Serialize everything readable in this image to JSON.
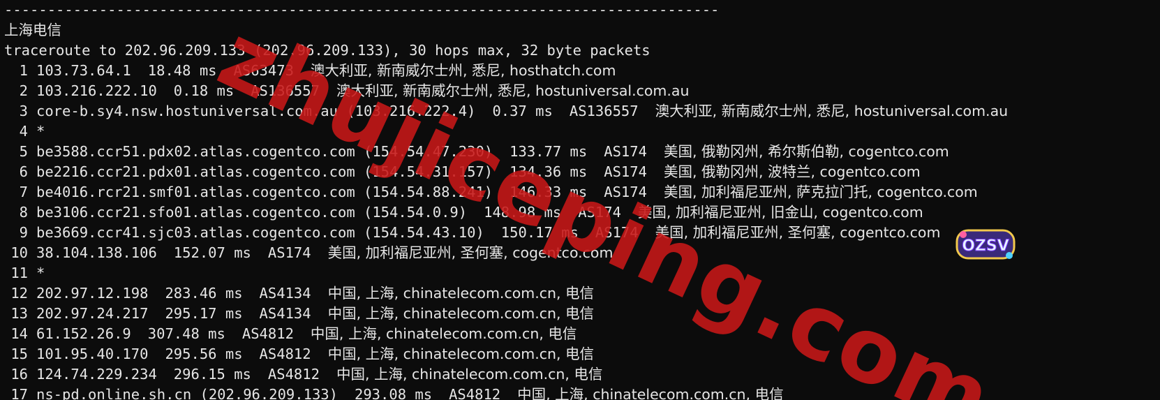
{
  "terminal": {
    "separator": "-----------------------------------------------------------------------------------",
    "title": "上海电信",
    "command": "traceroute to 202.96.209.133 (202.96.209.133), 30 hops max, 32 byte packets",
    "hops": [
      {
        "num": "1",
        "host": "103.73.64.1",
        "time": "18.48 ms",
        "asn": "AS63473",
        "geo": "澳大利亚, 新南威尔士州, 悉尼, hosthatch.com"
      },
      {
        "num": "2",
        "host": "103.216.222.10",
        "time": "0.18 ms",
        "asn": "AS136557",
        "geo": "澳大利亚, 新南威尔士州, 悉尼, hostuniversal.com.au"
      },
      {
        "num": "3",
        "host": "core-b.sy4.nsw.hostuniversal.com.au (103.216.222.4)",
        "time": "0.37 ms",
        "asn": "AS136557",
        "geo": "澳大利亚, 新南威尔士州, 悉尼, hostuniversal.com.au"
      },
      {
        "num": "4",
        "host": "*",
        "time": "",
        "asn": "",
        "geo": ""
      },
      {
        "num": "5",
        "host": "be3588.ccr51.pdx02.atlas.cogentco.com (154.54.47.230)",
        "time": "133.77 ms",
        "asn": "AS174",
        "geo": "美国, 俄勒冈州, 希尔斯伯勒, cogentco.com"
      },
      {
        "num": "6",
        "host": "be2216.ccr21.pdx01.atlas.cogentco.com (154.54.31.157)",
        "time": "134.36 ms",
        "asn": "AS174",
        "geo": "美国, 俄勒冈州, 波特兰, cogentco.com"
      },
      {
        "num": "7",
        "host": "be4016.rcr21.smf01.atlas.cogentco.com (154.54.88.241)",
        "time": "146.33 ms",
        "asn": "AS174",
        "geo": "美国, 加利福尼亚州, 萨克拉门托, cogentco.com"
      },
      {
        "num": "8",
        "host": "be3106.ccr21.sfo01.atlas.cogentco.com (154.54.0.9)",
        "time": "148.98 ms",
        "asn": "AS174",
        "geo": "美国, 加利福尼亚州, 旧金山, cogentco.com"
      },
      {
        "num": "9",
        "host": "be3669.ccr41.sjc03.atlas.cogentco.com (154.54.43.10)",
        "time": "150.17 ms",
        "asn": "AS174",
        "geo": "美国, 加利福尼亚州, 圣何塞, cogentco.com"
      },
      {
        "num": "10",
        "host": "38.104.138.106",
        "time": "152.07 ms",
        "asn": "AS174",
        "geo": "美国, 加利福尼亚州, 圣何塞, cogentco.com"
      },
      {
        "num": "11",
        "host": "*",
        "time": "",
        "asn": "",
        "geo": ""
      },
      {
        "num": "12",
        "host": "202.97.12.198",
        "time": "283.46 ms",
        "asn": "AS4134",
        "geo": "中国, 上海, chinatelecom.com.cn, 电信"
      },
      {
        "num": "13",
        "host": "202.97.24.217",
        "time": "295.17 ms",
        "asn": "AS4134",
        "geo": "中国, 上海, chinatelecom.com.cn, 电信"
      },
      {
        "num": "14",
        "host": "61.152.26.9",
        "time": "307.48 ms",
        "asn": "AS4812",
        "geo": "中国, 上海, chinatelecom.com.cn, 电信"
      },
      {
        "num": "15",
        "host": "101.95.40.170",
        "time": "295.56 ms",
        "asn": "AS4812",
        "geo": "中国, 上海, chinatelecom.com.cn, 电信"
      },
      {
        "num": "16",
        "host": "124.74.229.234",
        "time": "296.15 ms",
        "asn": "AS4812",
        "geo": "中国, 上海, chinatelecom.com.cn, 电信"
      },
      {
        "num": "17",
        "host": "ns-pd.online.sh.cn (202.96.209.133)",
        "time": "293.08 ms",
        "asn": "AS4812",
        "geo": "中国, 上海, chinatelecom.com.cn, 电信"
      }
    ]
  },
  "overlay": {
    "watermark_text": "zhujiceping.com",
    "badge_text": "OZSV",
    "watermark_color": "#c81818"
  }
}
